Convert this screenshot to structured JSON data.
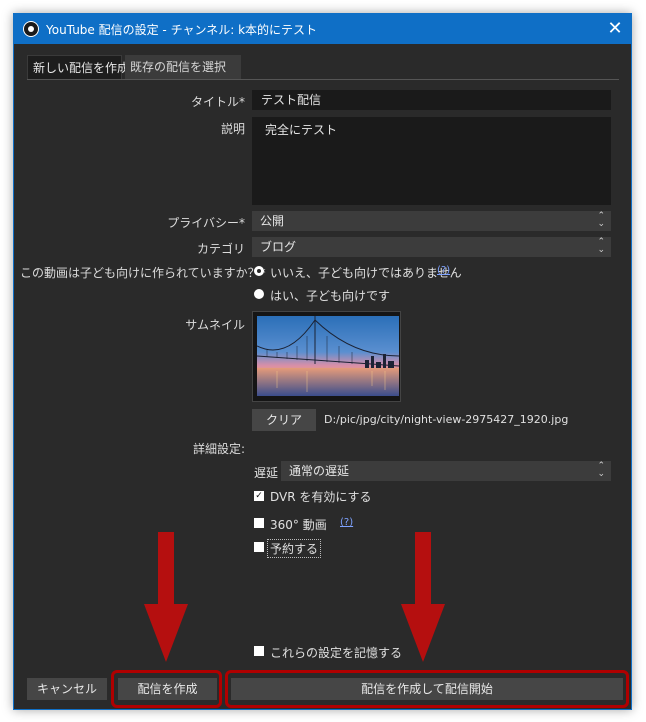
{
  "window": {
    "title": "YouTube 配信の設定 - チャンネル: k本的にテスト",
    "close_glyph": "✕"
  },
  "tabs": [
    {
      "label": "新しい配信を作成",
      "active": true
    },
    {
      "label": "既存の配信を選択",
      "active": false
    }
  ],
  "form": {
    "title_label": "タイトル*",
    "title_value": "テスト配信",
    "description_label": "説明",
    "description_value": "完全にテスト",
    "privacy_label": "プライバシー*",
    "privacy_value": "公開",
    "category_label": "カテゴリ",
    "category_value": "ブログ",
    "kids_label": "この動画は子ども向けに作られていますか？*",
    "kids_options": [
      {
        "label": "いいえ、子ども向けではありません",
        "selected": true
      },
      {
        "label": "はい、子ども向けです",
        "selected": false
      }
    ],
    "help_glyph": "(?)",
    "thumbnail_label": "サムネイル",
    "clear_button": "クリア",
    "thumbnail_path": "D:/pic/jpg/city/night-view-2975427_1920.jpg",
    "advanced_label": "詳細設定:",
    "latency_label": "遅延",
    "latency_value": "通常の遅延",
    "dvr_label": "DVR を有効にする",
    "dvr_checked": true,
    "check_glyph": "✓",
    "video360_label": "360° 動画",
    "video360_checked": false,
    "schedule_label": "予約する",
    "schedule_checked": false,
    "remember_label": "これらの設定を記憶する",
    "remember_checked": false
  },
  "footer": {
    "cancel_button": "キャンセル",
    "create_button": "配信を作成",
    "create_start_button": "配信を作成して配信開始"
  },
  "combo_arrows": "⌃⌄",
  "colors": {
    "titlebar": "#0f6fc6",
    "window_bg": "#2a2a2a",
    "accent_arrow": "#b50f0f",
    "highlight_box": "#b00000",
    "link": "#7fa3ff"
  }
}
